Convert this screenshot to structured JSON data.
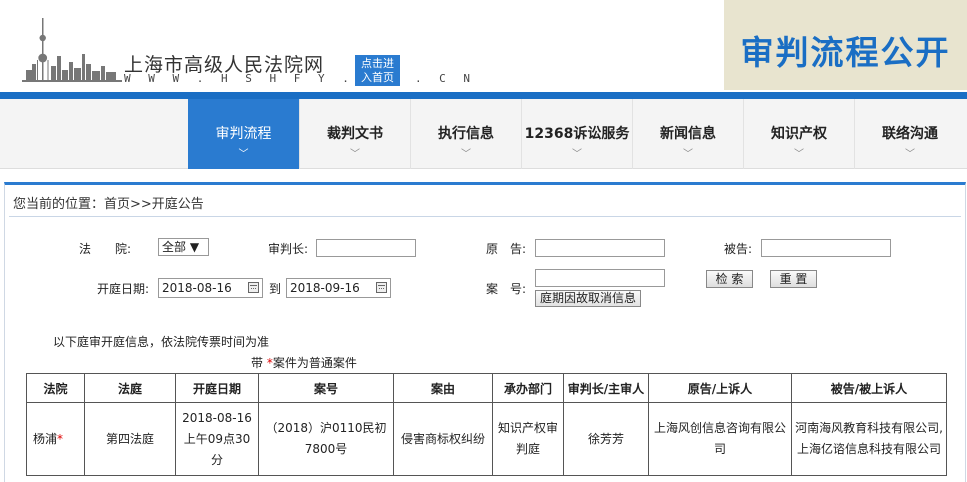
{
  "header": {
    "site_name": "上海市高级人民法院网",
    "site_url": "W W W . H S H F Y . S H . C N",
    "home_button_line1": "点击进",
    "home_button_line2": "入首页",
    "section_title": "审判流程公开"
  },
  "nav": {
    "items": [
      {
        "label": "审判流程",
        "active": true
      },
      {
        "label": "裁判文书"
      },
      {
        "label": "执行信息"
      },
      {
        "label": "12368诉讼服务"
      },
      {
        "label": "新闻信息"
      },
      {
        "label": "知识产权"
      },
      {
        "label": "联络沟通"
      }
    ],
    "chevron": "﹀"
  },
  "breadcrumb": "您当前的位置：首页>>开庭公告",
  "form": {
    "court_label": "法　　院:",
    "court_value": "全部",
    "chief_judge_label": "审判长:",
    "chief_judge_value": "",
    "plaintiff_label": "原　告:",
    "plaintiff_value": "",
    "defendant_label": "被告:",
    "defendant_value": "",
    "date_label": "开庭日期:",
    "date_from": "2018-08-16",
    "date_to_label": "到",
    "date_to": "2018-09-16",
    "case_no_label": "案　号:",
    "case_no_value": "",
    "cancel_info_button": "庭期因故取消信息",
    "search_button": "检 索",
    "reset_button": "重 置"
  },
  "notes": {
    "line1": "以下庭审开庭信息，依法院传票时间为准",
    "line2_prefix": "带 ",
    "line2_star": "*",
    "line2_suffix": "案件为普通案件"
  },
  "table": {
    "headers": [
      "法院",
      "法庭",
      "开庭日期",
      "案号",
      "案由",
      "承办部门",
      "审判长/主审人",
      "原告/上诉人",
      "被告/被上诉人"
    ],
    "rows": [
      {
        "court": "杨浦",
        "court_star": "*",
        "room": "第四法庭",
        "date": "2018-08-16上午09点30分",
        "case_no": "（2018）沪0110民初7800号",
        "cause": "侵害商标权纠纷",
        "department": "知识产权审判庭",
        "judge": "徐芳芳",
        "plaintiff": "上海风创信息咨询有限公司",
        "defendant": "河南海风教育科技有限公司,上海亿谘信息科技有限公司"
      }
    ]
  }
}
